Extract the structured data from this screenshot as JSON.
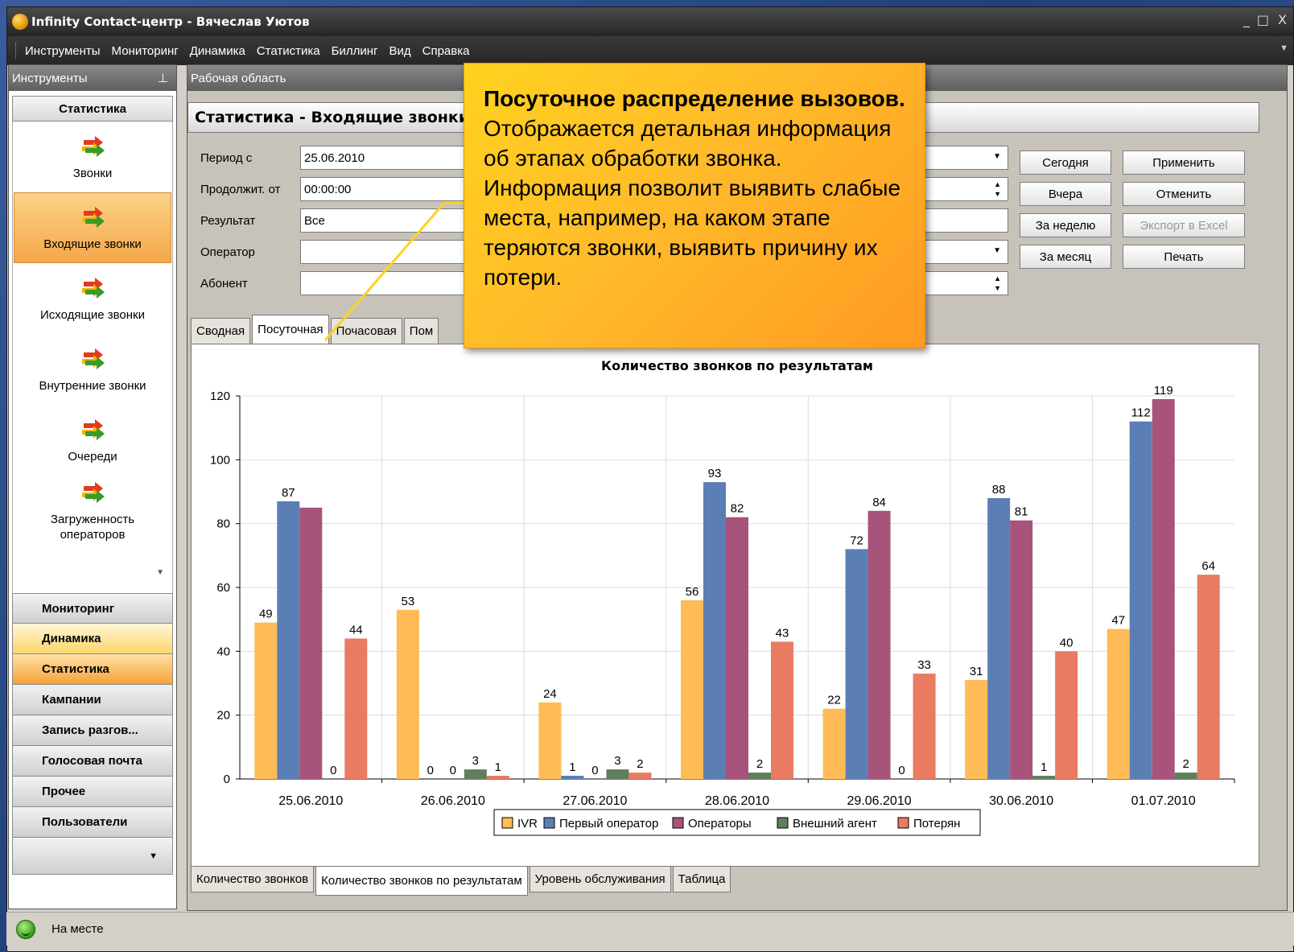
{
  "window": {
    "title": "Infinity Contact-центр  - Вячеслав Уютов",
    "controls": [
      "_",
      "□",
      "X"
    ]
  },
  "menu": [
    "Инструменты",
    "Мониторинг",
    "Динамика",
    "Статистика",
    "Биллинг",
    "Вид",
    "Справка"
  ],
  "tools_panel": {
    "title": "Инструменты",
    "pin_icon": "pin-icon",
    "category": "Статистика",
    "items": [
      {
        "label": "Звонки",
        "icon": "arrows-icon",
        "active": false
      },
      {
        "label": "Входящие звонки",
        "icon": "arrows-icon",
        "active": true
      },
      {
        "label": "Исходящие звонки",
        "icon": "arrows-icon",
        "active": false
      },
      {
        "label": "Внутренние звонки",
        "icon": "arrows-icon",
        "active": false
      },
      {
        "label": "Очереди",
        "icon": "arrows-icon",
        "active": false
      },
      {
        "label": "Загруженность операторов",
        "icon": "arrows-icon",
        "active": false
      }
    ],
    "nav": [
      {
        "label": "Мониторинг",
        "style": "normal"
      },
      {
        "label": "Динамика",
        "style": "yellow"
      },
      {
        "label": "Статистика",
        "style": "orange"
      },
      {
        "label": "Кампании",
        "style": "normal"
      },
      {
        "label": "Запись разгов...",
        "style": "normal"
      },
      {
        "label": "Голосовая почта",
        "style": "normal"
      },
      {
        "label": "Прочее",
        "style": "normal"
      },
      {
        "label": "Пользователи",
        "style": "normal"
      }
    ]
  },
  "workarea": {
    "title": "Рабочая область",
    "doc_title": "Статистика - Входящие звонки",
    "form": {
      "period_label": "Период с",
      "period_value": "25.06.2010",
      "duration_label": "Продолжит. от",
      "duration_value": "00:00:00",
      "result_label": "Результат",
      "result_value": "Все",
      "operator_label": "Оператор",
      "operator_value": "",
      "subscriber_label": "Абонент",
      "subscriber_value": ""
    },
    "buttons": {
      "today": "Сегодня",
      "yesterday": "Вчера",
      "week": "За неделю",
      "month": "За месяц",
      "apply": "Применить",
      "cancel": "Отменить",
      "export": "Экспорт в Excel",
      "print": "Печать"
    },
    "tabs_top": [
      "Сводная",
      "Посуточная",
      "Почасовая",
      "Пом"
    ],
    "tabs_top_active": 1,
    "tabs_bottom": [
      "Количество звонков",
      "Количество звонков по результатам",
      "Уровень обслуживания",
      "Таблица"
    ],
    "tabs_bottom_active": 1
  },
  "callout": {
    "title": "Посуточное распределение вызовов.",
    "body": "Отображается детальная информация об этапах обработки звонка. Информация позволит выявить слабые места, например, на каком этапе теряются звонки, выявить причину их потери."
  },
  "status": {
    "text": "На месте",
    "icon": "smiley-icon"
  },
  "chart_data": {
    "type": "bar",
    "title": "Количество звонков по результатам",
    "xlabel": "",
    "ylabel": "",
    "ylim": [
      0,
      120
    ],
    "yticks": [
      0,
      20,
      40,
      60,
      80,
      100,
      120
    ],
    "grid": true,
    "legend": "bottom",
    "categories": [
      "25.06.2010",
      "26.06.2010",
      "27.06.2010",
      "28.06.2010",
      "29.06.2010",
      "30.06.2010",
      "01.07.2010"
    ],
    "series": [
      {
        "name": "IVR",
        "color": "#ffbb55",
        "values": [
          49,
          53,
          24,
          56,
          22,
          31,
          47
        ],
        "labels": [
          "49",
          "53",
          "24",
          "56",
          "22",
          "31",
          "47"
        ]
      },
      {
        "name": "Первый оператор",
        "color": "#5b7fb5",
        "values": [
          87,
          0,
          1,
          93,
          72,
          88,
          112
        ],
        "labels": [
          "87",
          "0",
          "1",
          "93",
          "72",
          "88",
          "112"
        ]
      },
      {
        "name": "Операторы",
        "color": "#a8537a",
        "values": [
          85,
          0,
          0,
          82,
          84,
          81,
          119
        ],
        "labels": [
          "",
          "0",
          "0",
          "82",
          "84",
          "81",
          "119"
        ]
      },
      {
        "name": "Внешний агент",
        "color": "#5f7f5c",
        "values": [
          0,
          3,
          3,
          2,
          0,
          1,
          2
        ],
        "labels": [
          "0",
          "3",
          "3",
          "2",
          "0",
          "1",
          "2"
        ]
      },
      {
        "name": "Потерян",
        "color": "#e87b62",
        "values": [
          44,
          1,
          2,
          43,
          33,
          40,
          64
        ],
        "labels": [
          "44",
          "1",
          "2",
          "43",
          "33",
          "40",
          "64"
        ]
      }
    ]
  }
}
